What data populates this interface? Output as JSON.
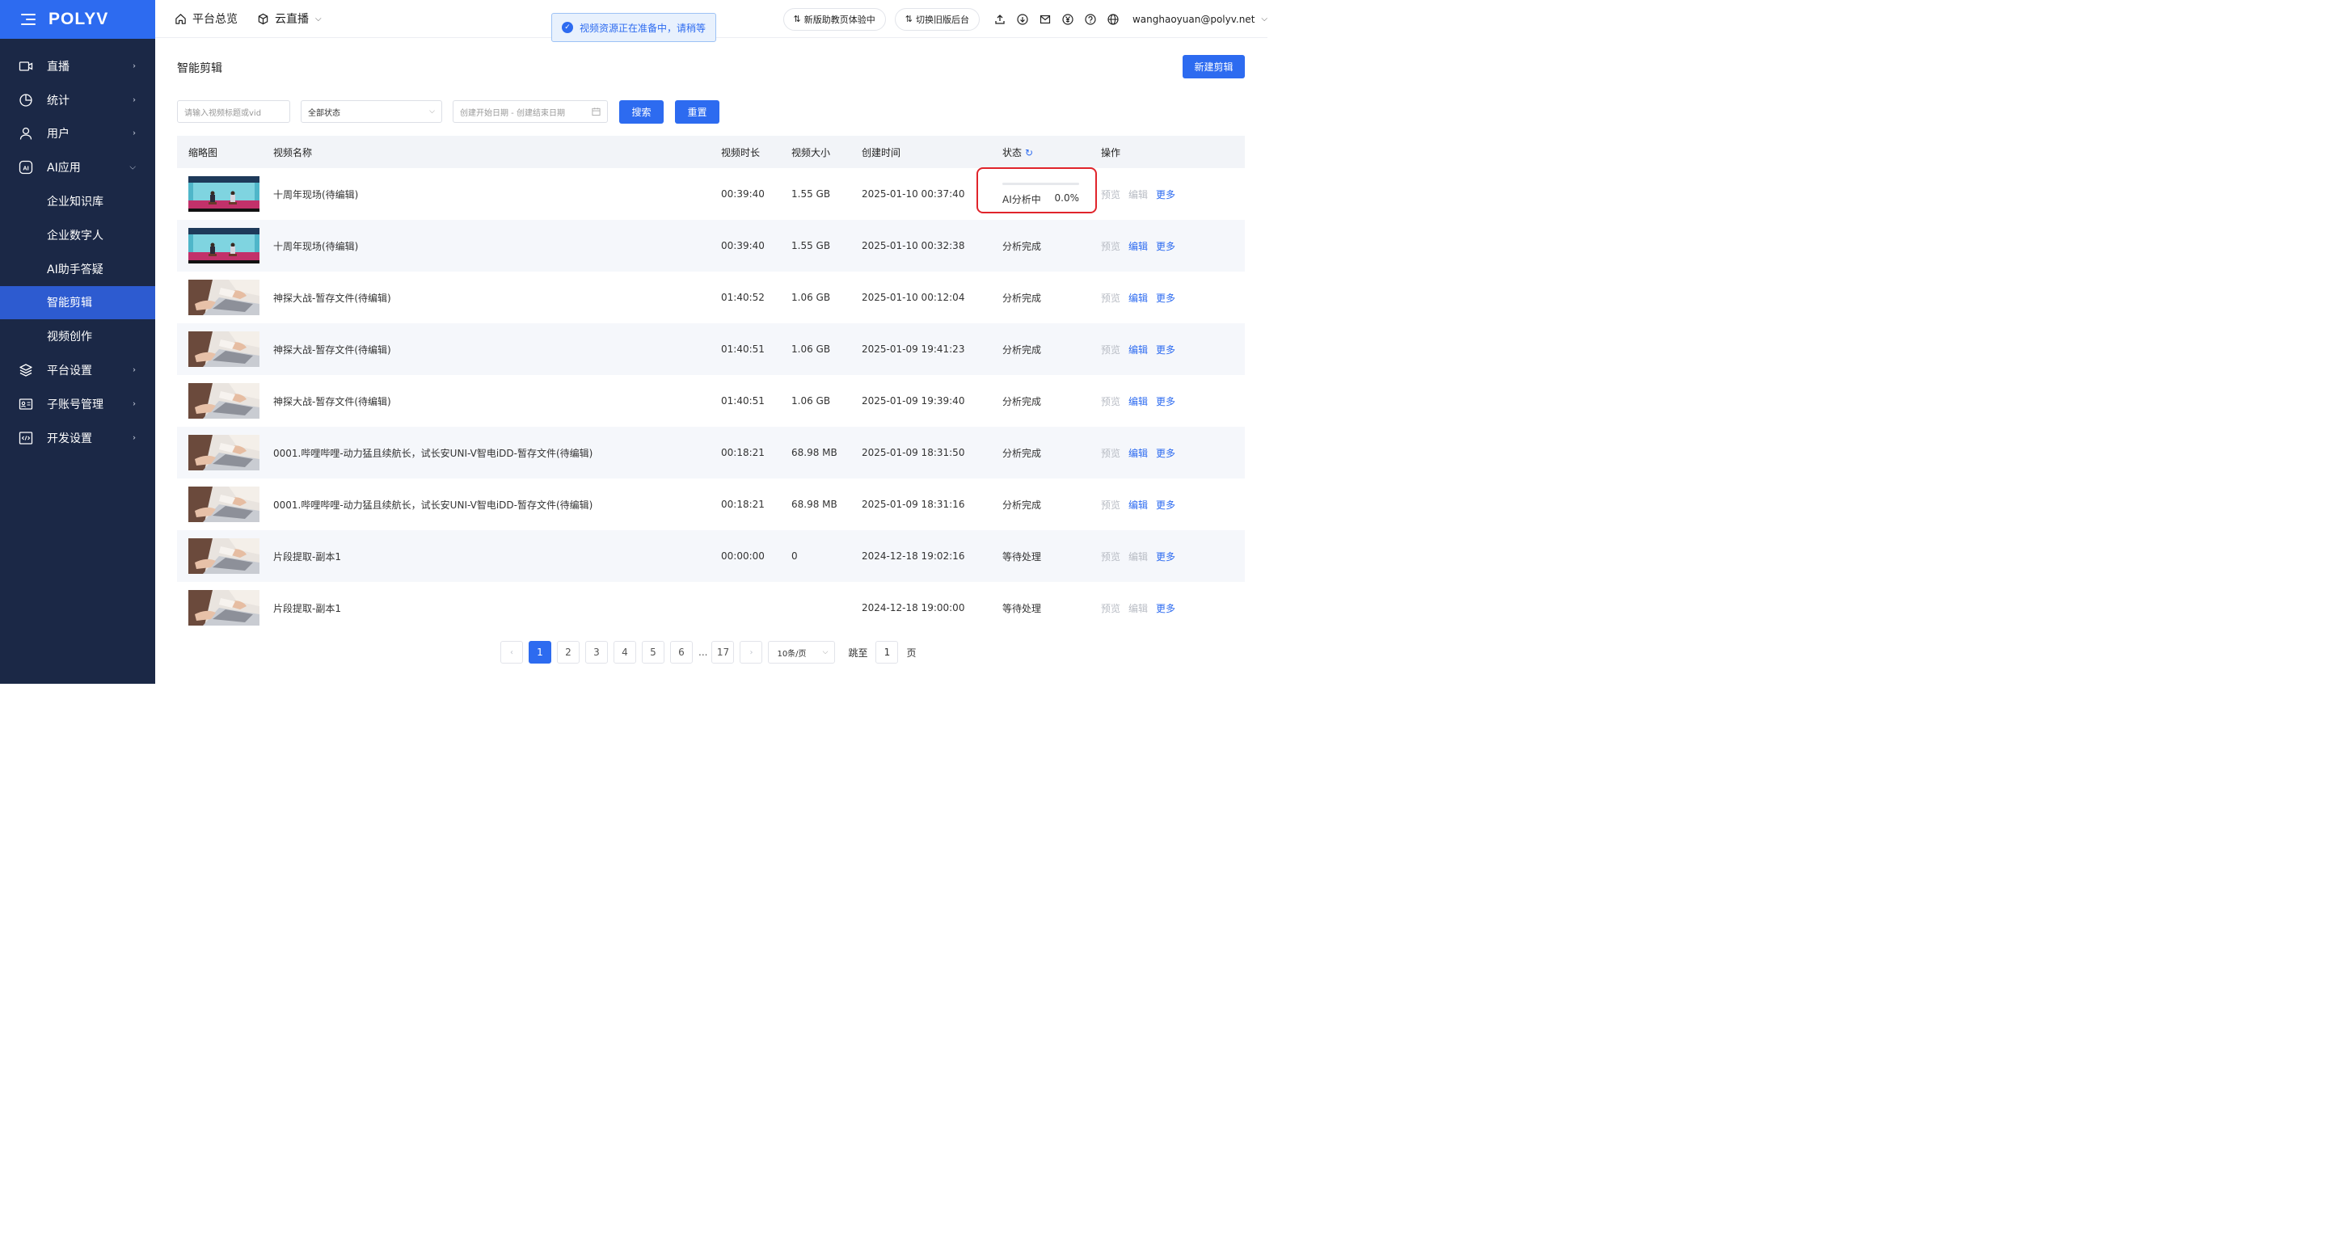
{
  "brand": {
    "logo": "POLYV",
    "accent": "#2d6bf0",
    "sidebar_bg": "#1b2846"
  },
  "sidebar": {
    "items": [
      {
        "label": "直播",
        "icon": "video-icon",
        "expandable": true
      },
      {
        "label": "统计",
        "icon": "pie-chart-icon",
        "expandable": true
      },
      {
        "label": "用户",
        "icon": "user-icon",
        "expandable": true
      },
      {
        "label": "AI应用",
        "icon": "ai-icon",
        "expandable": true,
        "expanded": true
      },
      {
        "label": "企业知识库",
        "sub": true
      },
      {
        "label": "企业数字人",
        "sub": true
      },
      {
        "label": "AI助手答疑",
        "sub": true
      },
      {
        "label": "智能剪辑",
        "sub": true,
        "active": true
      },
      {
        "label": "视频创作",
        "sub": true
      },
      {
        "label": "平台设置",
        "icon": "layers-icon",
        "expandable": true
      },
      {
        "label": "子账号管理",
        "icon": "id-card-icon",
        "expandable": true
      },
      {
        "label": "开发设置",
        "icon": "code-icon",
        "expandable": true
      }
    ]
  },
  "topbar": {
    "home_label": "平台总览",
    "product_label": "云直播",
    "toast": "视频资源正在准备中，请稍等",
    "new_ui_label": "新版助教页体验中",
    "old_ui_label": "切换旧版后台",
    "user_email": "wanghaoyuan@polyv.net"
  },
  "page": {
    "title": "智能剪辑",
    "new_button": "新建剪辑"
  },
  "filters": {
    "search_placeholder": "请输入视频标题或vid",
    "status_value": "全部状态",
    "date_placeholder": "创建开始日期 - 创建结束日期",
    "search_button": "搜索",
    "reset_button": "重置"
  },
  "table": {
    "headers": {
      "thumb": "缩略图",
      "name": "视频名称",
      "duration": "视频时长",
      "size": "视频大小",
      "created": "创建时间",
      "status": "状态",
      "ops": "操作"
    },
    "rows": [
      {
        "name": "十周年现场(待编辑)",
        "duration": "00:39:40",
        "size": "1.55 GB",
        "created": "2025-01-10 00:37:40",
        "status": "AI分析中",
        "progress": "0.0%",
        "thumb": "stage",
        "preview": "预览",
        "edit": "编辑",
        "more": "更多",
        "edit_enabled": false
      },
      {
        "name": "十周年现场(待编辑)",
        "duration": "00:39:40",
        "size": "1.55 GB",
        "created": "2025-01-10 00:32:38",
        "status": "分析完成",
        "thumb": "stage",
        "preview": "预览",
        "edit": "编辑",
        "more": "更多",
        "edit_enabled": true
      },
      {
        "name": "神探大战-暂存文件(待编辑)",
        "duration": "01:40:52",
        "size": "1.06 GB",
        "created": "2025-01-10 00:12:04",
        "status": "分析完成",
        "thumb": "laptop",
        "preview": "预览",
        "edit": "编辑",
        "more": "更多",
        "edit_enabled": true
      },
      {
        "name": "神探大战-暂存文件(待编辑)",
        "duration": "01:40:51",
        "size": "1.06 GB",
        "created": "2025-01-09 19:41:23",
        "status": "分析完成",
        "thumb": "laptop",
        "preview": "预览",
        "edit": "编辑",
        "more": "更多",
        "edit_enabled": true
      },
      {
        "name": "神探大战-暂存文件(待编辑)",
        "duration": "01:40:51",
        "size": "1.06 GB",
        "created": "2025-01-09 19:39:40",
        "status": "分析完成",
        "thumb": "laptop",
        "preview": "预览",
        "edit": "编辑",
        "more": "更多",
        "edit_enabled": true
      },
      {
        "name": "0001.哔哩哔哩-动力猛且续航长，试长安UNI-V智电iDD-暂存文件(待编辑)",
        "duration": "00:18:21",
        "size": "68.98 MB",
        "created": "2025-01-09 18:31:50",
        "status": "分析完成",
        "thumb": "laptop",
        "preview": "预览",
        "edit": "编辑",
        "more": "更多",
        "edit_enabled": true
      },
      {
        "name": "0001.哔哩哔哩-动力猛且续航长，试长安UNI-V智电iDD-暂存文件(待编辑)",
        "duration": "00:18:21",
        "size": "68.98 MB",
        "created": "2025-01-09 18:31:16",
        "status": "分析完成",
        "thumb": "laptop",
        "preview": "预览",
        "edit": "编辑",
        "more": "更多",
        "edit_enabled": true
      },
      {
        "name": "片段提取-副本1",
        "duration": "00:00:00",
        "size": "0",
        "created": "2024-12-18 19:02:16",
        "status": "等待处理",
        "thumb": "laptop",
        "preview": "预览",
        "edit": "编辑",
        "more": "更多",
        "edit_enabled": false
      },
      {
        "name": "片段提取-副本1",
        "duration": "",
        "size": "",
        "created": "2024-12-18 19:00:00",
        "status": "等待处理",
        "thumb": "laptop",
        "preview": "预览",
        "edit": "编辑",
        "more": "更多",
        "edit_enabled": false
      }
    ]
  },
  "pagination": {
    "pages": [
      "1",
      "2",
      "3",
      "4",
      "5",
      "6"
    ],
    "ellipsis": "...",
    "last_page": "17",
    "current": "1",
    "page_size": "10条/页",
    "jump_label": "跳至",
    "jump_value": "1",
    "page_suffix": "页"
  }
}
